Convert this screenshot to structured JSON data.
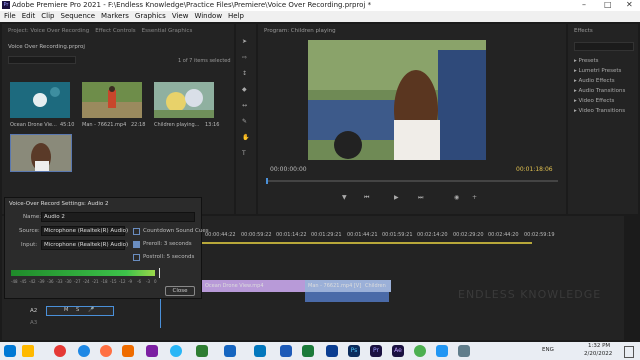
{
  "window": {
    "title": "Adobe Premiere Pro 2021 - F:\\Endless Knowledge\\Practice Files\\Premiere\\Voice Over Recording.prproj *",
    "app_icon": "Pr"
  },
  "menu": [
    "File",
    "Edit",
    "Clip",
    "Sequence",
    "Markers",
    "Graphics",
    "View",
    "Window",
    "Help"
  ],
  "project_panel": {
    "tabs": [
      "Project: Voice Over Recording",
      "Effect Controls",
      "Essential Graphics"
    ],
    "path": "Voice Over Recording.prproj",
    "selection_info": "1 of 7 items selected",
    "items": [
      {
        "name": "Ocean Drone Vie...",
        "duration": "45:10"
      },
      {
        "name": "Man - 76621.mp4",
        "duration": "22:18"
      },
      {
        "name": "Children playing...",
        "duration": "13:16"
      }
    ]
  },
  "program_monitor": {
    "title": "Program: Children playing",
    "timecode_left": "00:00:00:00",
    "timecode_right": "00:01:18:06"
  },
  "effects_panel": {
    "title": "Effects",
    "items": [
      "Presets",
      "Lumetri Presets",
      "Audio Effects",
      "Audio Transitions",
      "Video Effects",
      "Video Transitions"
    ]
  },
  "voiceover_dialog": {
    "title": "Voice-Over Record Settings: Audio 2",
    "name_label": "Name:",
    "name_value": "Audio 2",
    "source_label": "Source:",
    "source_value": "Microphone (Realtek(R) Audio)",
    "input_label": "Input:",
    "input_value": "Microphone (Realtek(R) Audio)",
    "countdown_label": "Countdown Sound Cues",
    "preroll_label": "Preroll: 3 seconds",
    "postroll_label": "Postroll: 5 seconds",
    "meter_scale": [
      "-48",
      "-45",
      "-42",
      "-39",
      "-36",
      "-33",
      "-30",
      "-27",
      "-24",
      "-21",
      "-18",
      "-15",
      "-12",
      "-9",
      "-6",
      "-3",
      "0"
    ],
    "close_label": "Close"
  },
  "timeline": {
    "timecodes": [
      "00:00:44:22",
      "00:00:59:22",
      "00:01:14:22",
      "00:01:29:21",
      "00:01:44:21",
      "00:01:59:21",
      "00:02:14:20",
      "00:02:29:20",
      "00:02:44:20",
      "00:02:59:19"
    ],
    "clips": [
      "Ocean Drone View.mp4",
      "Man - 76621.mp4 [V]",
      "Children"
    ],
    "track_a2": "A2",
    "track_a3": "A3",
    "track_m": "M",
    "track_s": "S",
    "watermark": "ENDLESS KNOWLEDGE"
  },
  "taskbar": {
    "lang": "ENG",
    "time": "1:32 PM",
    "date": "2/20/2022"
  }
}
